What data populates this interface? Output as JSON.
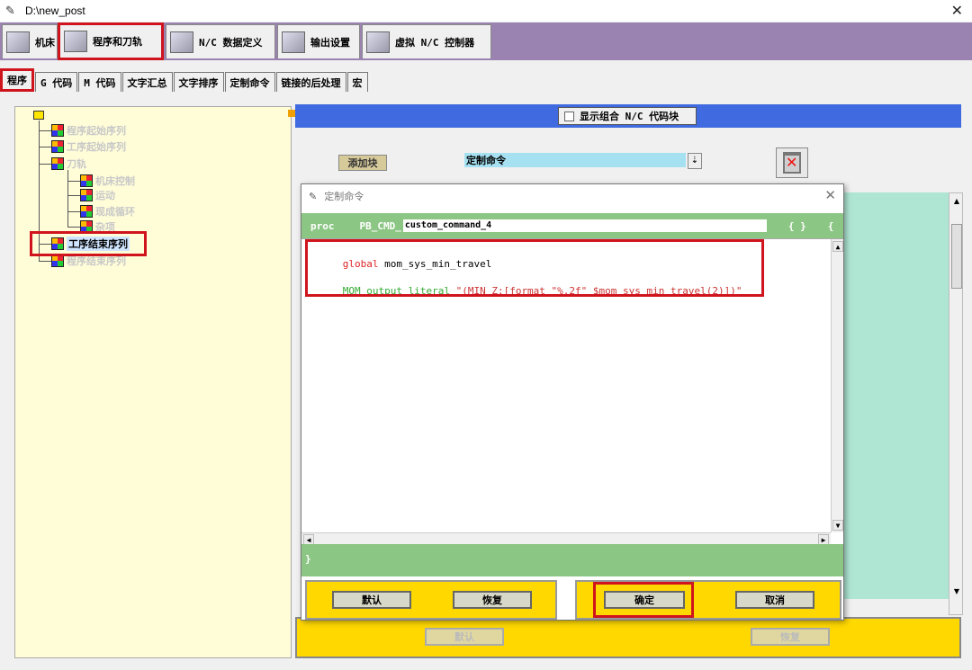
{
  "window": {
    "title": "D:\\new_post"
  },
  "main_tabs": [
    {
      "label": "机床"
    },
    {
      "label": "程序和刀轨"
    },
    {
      "label": "N/C 数据定义"
    },
    {
      "label": "输出设置"
    },
    {
      "label": "虚拟 N/C 控制器"
    }
  ],
  "sub_tabs": [
    {
      "label": "程序"
    },
    {
      "label": "G 代码"
    },
    {
      "label": "M 代码"
    },
    {
      "label": "文字汇总"
    },
    {
      "label": "文字排序"
    },
    {
      "label": "定制命令"
    },
    {
      "label": "链接的后处理"
    },
    {
      "label": "宏"
    }
  ],
  "tree": {
    "nodes": [
      {
        "label": "程序起始序列"
      },
      {
        "label": "工序起始序列"
      },
      {
        "label": "刀轨"
      },
      {
        "label": "机床控制"
      },
      {
        "label": "运动"
      },
      {
        "label": "现成循环"
      },
      {
        "label": "杂项"
      },
      {
        "label": "工序结束序列"
      },
      {
        "label": "程序结束序列"
      }
    ]
  },
  "right_panel": {
    "combo_checkbox_label": "显示组合 N/C 代码块",
    "add_block_label": "添加块",
    "block_select_value": "定制命令",
    "select_arrow": "⇣",
    "default_button": "默认",
    "restore_button": "恢复"
  },
  "dialog": {
    "title": "定制命令",
    "proc_keyword": "proc",
    "proc_prefix": "PB_CMD_",
    "proc_name": "custom_command_4",
    "open_braces": "{ }",
    "open_brace_cut": "{",
    "code_line1_kw": "global",
    "code_line1_rest": " mom_sys_min_travel",
    "code_line2_kw": "MOM_output_literal",
    "code_line2_rest": " \"(MIN_Z:[format \"%.2f\" $mom_sys_min_travel(2)])\"",
    "close_brace": "}",
    "default_button": "默认",
    "restore_button": "恢复",
    "ok_button": "确定",
    "cancel_button": "取消"
  },
  "colors": {
    "accent_red": "#d0141e",
    "tab_strip": "#9a83b0",
    "tree_bg": "#fffdd8",
    "blue_bar": "#3f6ae0",
    "green": "#8cc684",
    "mint": "#afe6d3",
    "yellow": "#ffd800"
  }
}
